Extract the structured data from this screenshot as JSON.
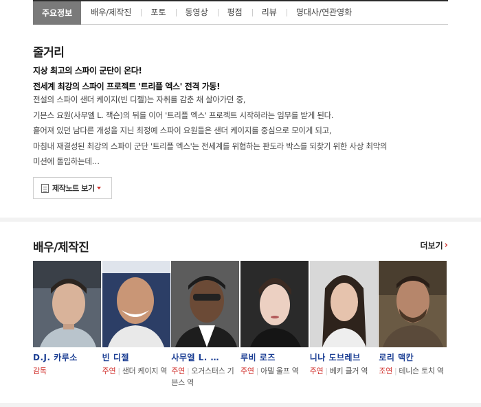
{
  "tabs": [
    {
      "label": "주요정보",
      "active": true
    },
    {
      "label": "배우/제작진",
      "active": false
    },
    {
      "label": "포토",
      "active": false
    },
    {
      "label": "동영상",
      "active": false
    },
    {
      "label": "평점",
      "active": false
    },
    {
      "label": "리뷰",
      "active": false
    },
    {
      "label": "명대사/연관영화",
      "active": false
    }
  ],
  "synopsis": {
    "title": "줄거리",
    "headline1": "지상 최고의 스파이 군단이 온다!",
    "headline2": "전세계 최강의 스파이 프로젝트 '트리플 엑스' 전격 가동!",
    "lines": [
      "전설의 스파이 샌더 케이지(빈 디젤)는 자취를 감춘 채 살아가던 중,",
      " 기븐스 요원(사무엘 L. 잭슨)의 뒤를 이어 '트리플 엑스' 프로젝트 시작하라는 임무를 받게 된다.",
      " 흩어져 있던 남다른 개성을 지닌 최정예 스파이 요원들은 샌더 케이지를 중심으로 모이게 되고,",
      " 마침내 재결성된 최강의 스파이 군단 '트리플 엑스'는 전세계를 위협하는 판도라 박스를 되찾기 위한 사상 최악의",
      "미션에 돌입하는데…"
    ],
    "notes_button": "제작노트 보기"
  },
  "cast_section": {
    "title": "배우/제작진",
    "more_label": "더보기",
    "people": [
      {
        "name": "D.J. 카루소",
        "role_type": "감독",
        "role": ""
      },
      {
        "name": "빈 디젤",
        "role_type": "주연",
        "role": "샌더 케이지 역"
      },
      {
        "name": "사무엘 L. …",
        "role_type": "주연",
        "role": "오거스터스 기븐스 역"
      },
      {
        "name": "루비 로즈",
        "role_type": "주연",
        "role": "아델 울프 역"
      },
      {
        "name": "니나 도브레브",
        "role_type": "주연",
        "role": "베키 클거 역"
      },
      {
        "name": "로리 맥칸",
        "role_type": "조연",
        "role": "테니슨 토치 역"
      }
    ]
  }
}
